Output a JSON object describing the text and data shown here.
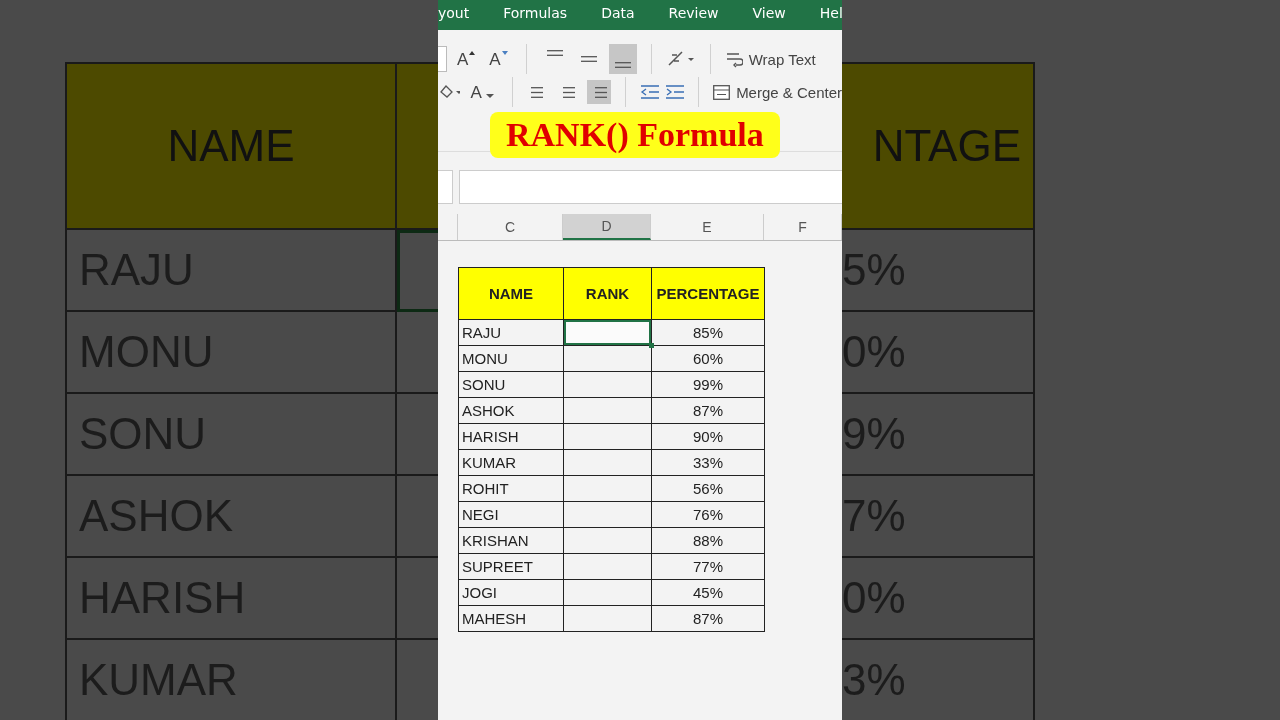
{
  "backdrop": {
    "left": {
      "header": "NAME",
      "cells": [
        "RAJU",
        "MONU",
        "SONU",
        "ASHOK",
        "HARISH",
        "KUMAR"
      ]
    },
    "right": {
      "header": "NTAGE",
      "cells": [
        "5%",
        "0%",
        "9%",
        "7%",
        "0%",
        "3%"
      ]
    }
  },
  "ribbon_tabs": [
    "yout",
    "Formulas",
    "Data",
    "Review",
    "View",
    "Hel"
  ],
  "ribbon": {
    "font_buttons": [
      {
        "kind": "grow",
        "label": "A"
      },
      {
        "kind": "shrink",
        "label": "A"
      }
    ],
    "font_color": {
      "label": "A"
    },
    "align_row1": [
      {
        "kind": "top",
        "selected": false
      },
      {
        "kind": "middle",
        "selected": false
      },
      {
        "kind": "bottom",
        "selected": true
      }
    ],
    "align_row2": [
      {
        "kind": "left",
        "selected": false
      },
      {
        "kind": "center",
        "selected": false
      },
      {
        "kind": "right",
        "selected": true
      }
    ],
    "wrap_text": "Wrap Text",
    "merge": "Merge & Center"
  },
  "overlay_title": "RANK() Formula",
  "column_headers": [
    {
      "label": "C",
      "selected": false
    },
    {
      "label": "D",
      "selected": true
    },
    {
      "label": "E",
      "selected": false
    },
    {
      "label": "F",
      "selected": false
    }
  ],
  "table": {
    "columns": [
      "NAME",
      "RANK",
      "PERCENTAGE"
    ],
    "rows": [
      {
        "name": "RAJU",
        "percentage": "85%",
        "selected": true
      },
      {
        "name": "MONU",
        "percentage": "60%",
        "selected": false
      },
      {
        "name": "SONU",
        "percentage": "99%",
        "selected": false
      },
      {
        "name": "ASHOK",
        "percentage": "87%",
        "selected": false
      },
      {
        "name": "HARISH",
        "percentage": "90%",
        "selected": false
      },
      {
        "name": "KUMAR",
        "percentage": "33%",
        "selected": false
      },
      {
        "name": "ROHIT",
        "percentage": "56%",
        "selected": false
      },
      {
        "name": "NEGI",
        "percentage": "76%",
        "selected": false
      },
      {
        "name": "KRISHAN",
        "percentage": "88%",
        "selected": false
      },
      {
        "name": "SUPREET",
        "percentage": "77%",
        "selected": false
      },
      {
        "name": "JOGI",
        "percentage": "45%",
        "selected": false
      },
      {
        "name": "MAHESH",
        "percentage": "87%",
        "selected": false
      }
    ]
  }
}
